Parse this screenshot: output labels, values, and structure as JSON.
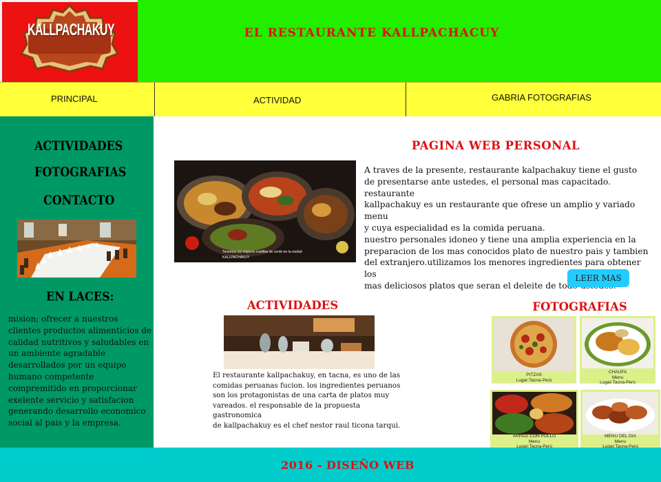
{
  "header": {
    "logo_text": "KALLPACHAKUY",
    "title": "EL RESTAURANTE KALLPACHACUY"
  },
  "nav": {
    "items": [
      {
        "label": "PRINCIPAL"
      },
      {
        "label": "ACTIVIDAD"
      },
      {
        "label": "GABRIA FOTOGRAFIAS"
      }
    ]
  },
  "sidebar": {
    "links": [
      {
        "label": "ACTIVIDADES"
      },
      {
        "label": "FOTOGRAFIAS"
      },
      {
        "label": "CONTACTO"
      }
    ],
    "enlaces_title": "EN LACES:",
    "mision_text": "mision; ofrecer a nuestros clientes productos alimenticios de calidad nutritivos y saludables en un ambiente agradable desarrollados por un equipo humano competente compremitido en proporcionar exelente servicio y satisfacion generando desarrollo economico social al pais y la empresa."
  },
  "main": {
    "title": "PAGINA WEB PERSONAL",
    "photo_caption_line1": "Tenemos los mejores costillas de cerdo en la ciudad",
    "photo_caption_line2": "KALLPACHAKUY",
    "intro_lines": [
      "A traves de la presente, restaurante kalpachakuy tiene el gusto",
      "de presentarse ante ustedes, el personal mas capacitado. restaurante",
      "kallpachakuy es un restaurante que ofrese un amplio y variado menu",
      "y cuya especialidad es la comida peruana.",
      "nuestro personales idoneo y tiene una amplia experiencia en la",
      "preparacion de los mas conocidos plato de nuestro pais y tambien",
      "del extranjero.utilizamos los menores ingredientes para obtener los",
      "mas deliciosos platos que seran el deleite de todo ustedes."
    ],
    "read_more_label": "LEER MAS"
  },
  "actividades": {
    "title": "ACTIVIDADES",
    "text_lines": [
      "El restaurante kallpachakuy, en tacna, es uno de las",
      "comidas peruanas fucion. los ingredientes peruanos",
      "son los protagonistas de una carta de platos muy",
      "vareados. el responsable de la propuesta gastronomica",
      "de kallpachakuy es el chef  nestor raul ticona tarqui."
    ]
  },
  "fotografias": {
    "title": "FOTOGRAFIAS",
    "cards": [
      {
        "name": "PITZAS",
        "sub": "",
        "place": "Lugar:Tacna-Perú"
      },
      {
        "name": "CHAUFA",
        "sub": "Menu",
        "place": "Lugar:Tacna-Perú"
      },
      {
        "name": "ARROZ CON POLLO",
        "sub": "Menu",
        "place": "Lugar:Tacna-Perú"
      },
      {
        "name": "MENU DEL DIA",
        "sub": "Menu",
        "place": "Lugar:Tacna-Perú"
      }
    ]
  },
  "footer": {
    "text": "2016 - DISEÑO WEB"
  },
  "colors": {
    "header_green": "#22ee00",
    "nav_yellow": "#ffff3a",
    "sidebar_green": "#009966",
    "footer_cyan": "#00cccc",
    "title_red": "#dd1111",
    "button_blue": "#22ccff"
  }
}
